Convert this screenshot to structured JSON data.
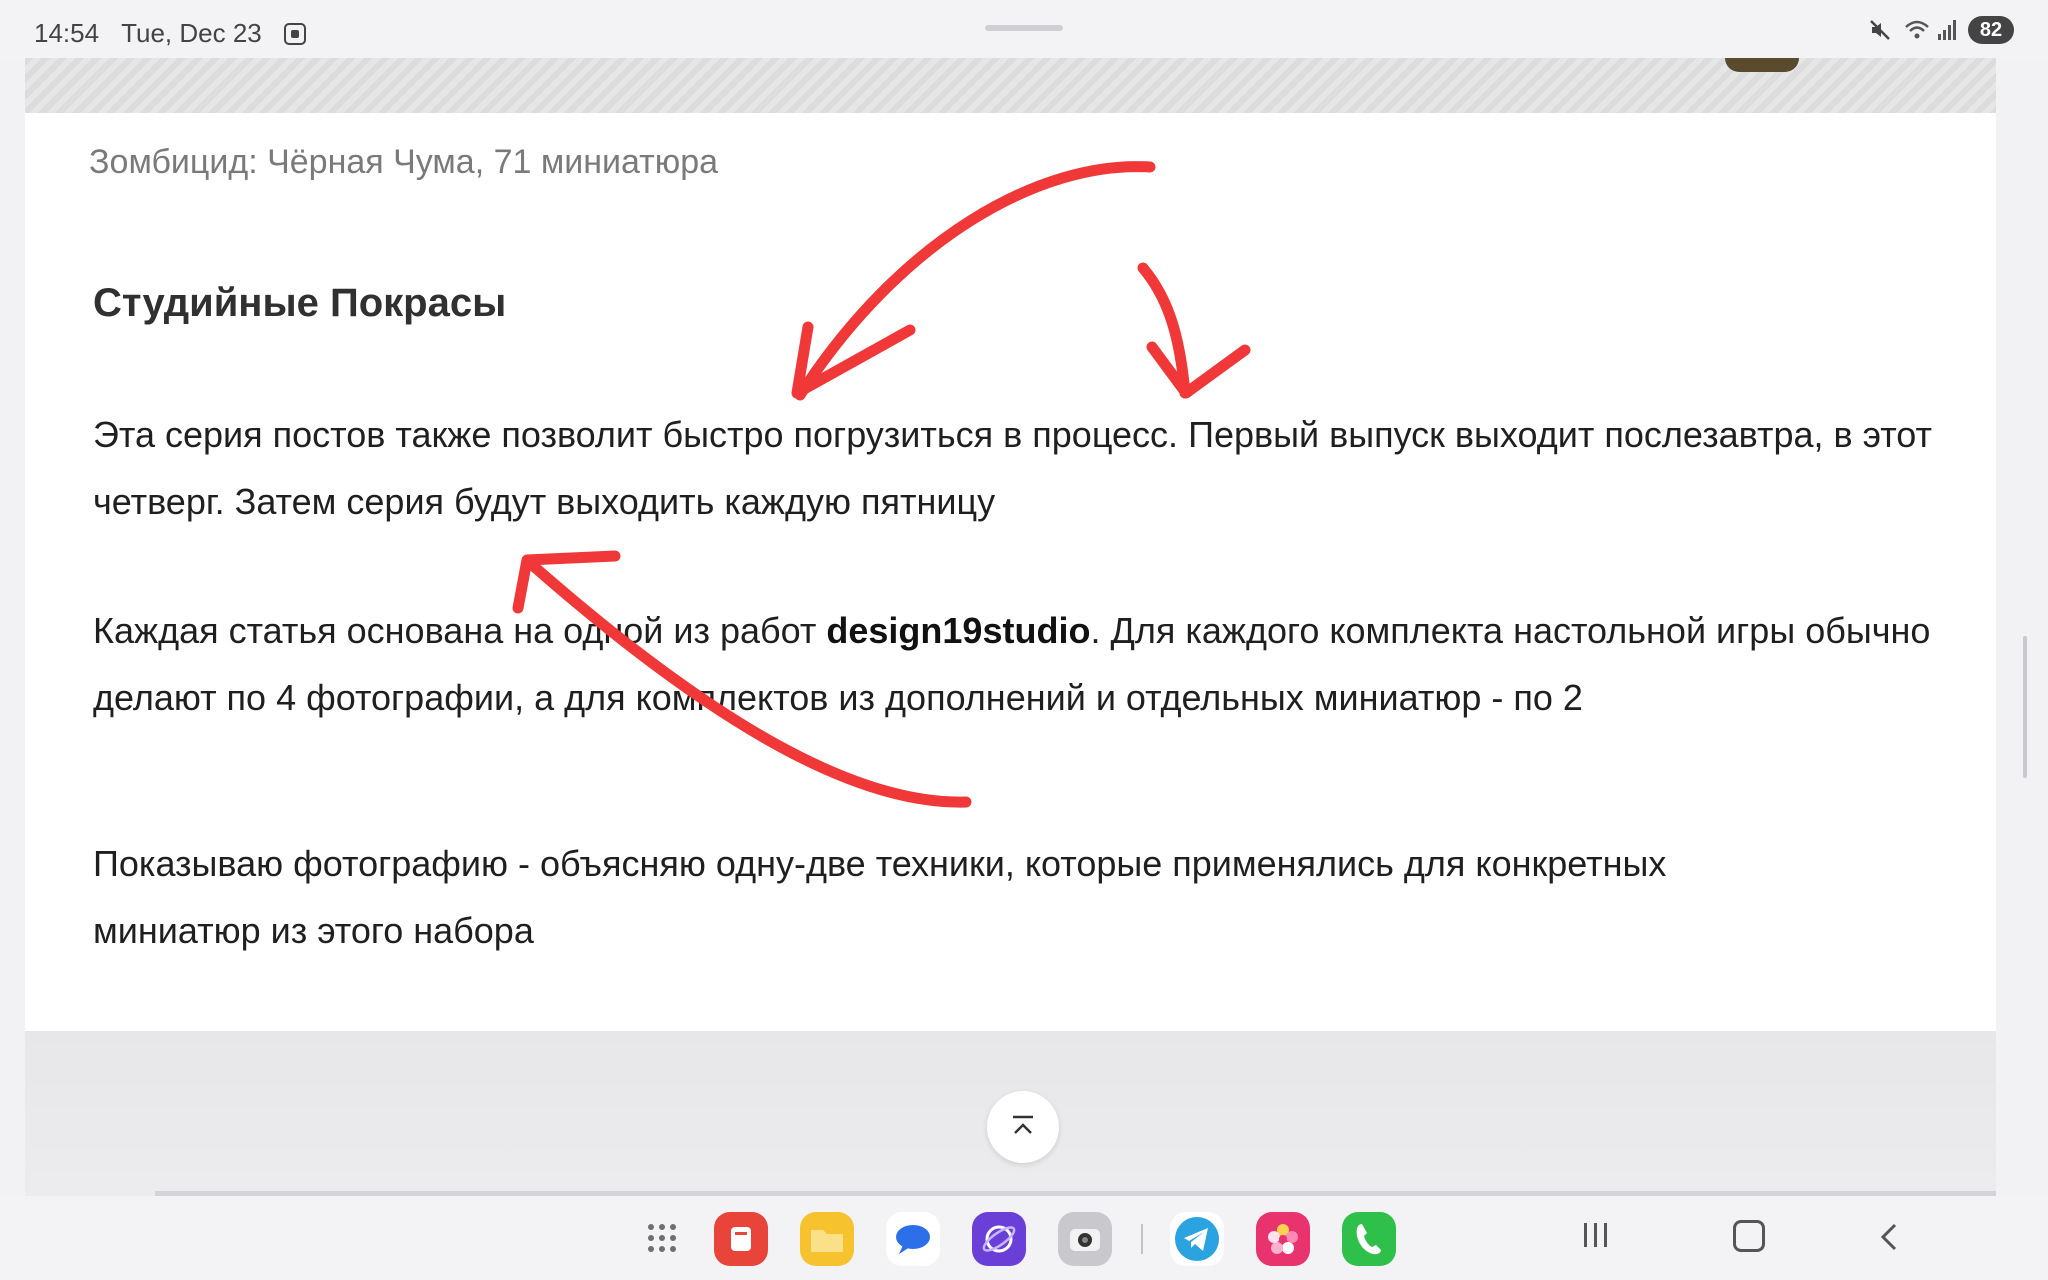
{
  "status_bar": {
    "time": "14:54",
    "date": "Tue, Dec 23",
    "battery": "82"
  },
  "article": {
    "caption": "Зомбицид: Чёрная Чума, 71 миниатюра",
    "heading": "Студийные Покрасы",
    "paragraph1": "Эта серия постов также позволит быстро погрузиться в процесс. Первый выпуск выходит послезавтра, в этот четверг. Затем серия будут выходить каждую пятницу",
    "paragraph2_before": "Каждая статья основана на одной из работ ",
    "paragraph2_bold": "design19studio",
    "paragraph2_after": ". Для каждого комплекта настольной игры обычно делают по 4 фотографии, а для комплектов из дополнений и отдельных миниатюр - по 2",
    "paragraph3_line1": "Показываю фотографию - объясняю одну-две техники, которые применялись для конкретных",
    "paragraph3_line2": "миниатюр из этого набора"
  },
  "colors": {
    "annotation": "#f03838",
    "background": "#f2f2f4",
    "card": "#ffffff"
  },
  "icons": {
    "status": [
      "screenshot-icon",
      "mute-icon",
      "wifi-icon",
      "signal-icon"
    ],
    "dock": [
      "app-drawer-icon",
      "notes-app-icon",
      "files-app-icon",
      "messages-app-icon",
      "internet-browser-icon",
      "camera-app-icon",
      "telegram-app-icon",
      "gallery-app-icon",
      "phone-app-icon"
    ],
    "nav": [
      "recents-icon",
      "home-icon",
      "back-icon"
    ]
  }
}
